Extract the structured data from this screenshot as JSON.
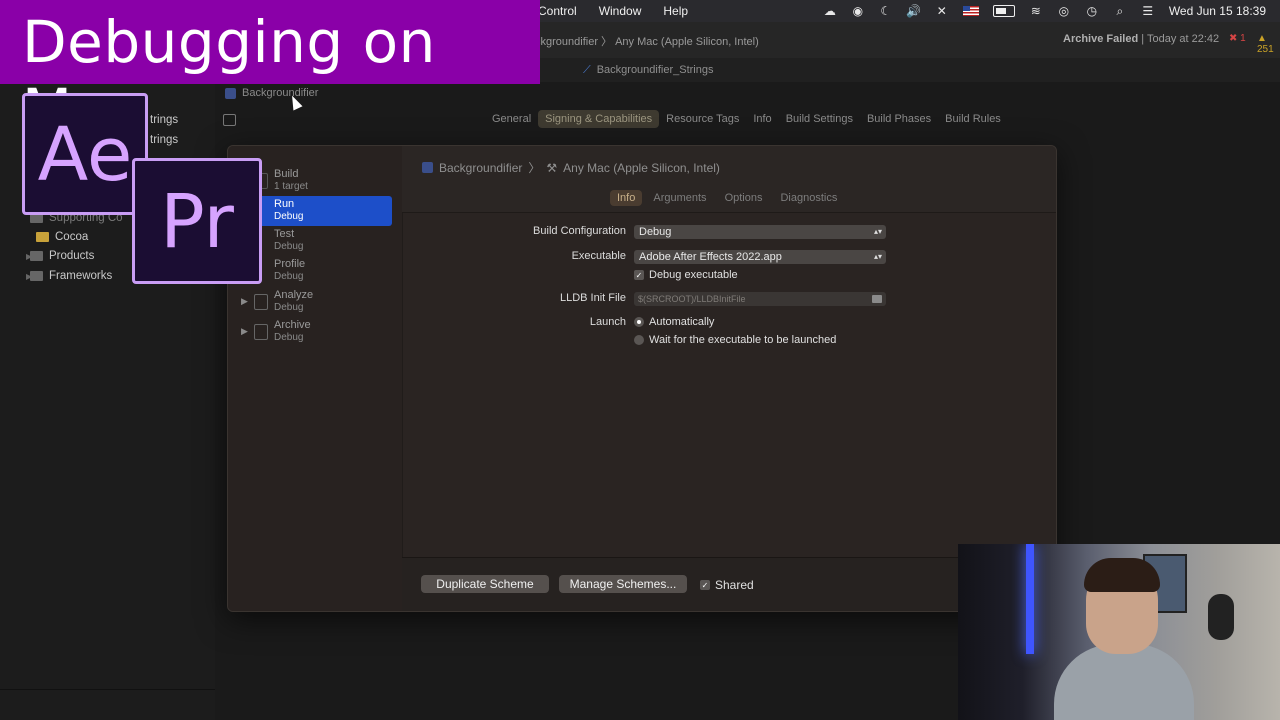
{
  "overlay": {
    "title": "Debugging on Mac",
    "ae_logo": "Ae",
    "pr_logo": "Pr"
  },
  "menubar": {
    "items": [
      "Control",
      "Window",
      "Help"
    ],
    "clock": "Wed Jun 15  18:39"
  },
  "toolbar": {
    "breadcrumb": "ckgroundifier 〉 Any Mac (Apple Silicon, Intel)",
    "status_label": "Archive Failed",
    "status_time": "| Today at 22:42",
    "errors": "1",
    "warnings": "251"
  },
  "tabbar": {
    "file_tab": "Backgroundifier_Strings"
  },
  "navigator": {
    "items": [
      {
        "label": "trings"
      },
      {
        "label": "trings"
      },
      {
        "label": "Supporting Co"
      },
      {
        "label": "Cocoa"
      },
      {
        "label": "Products"
      },
      {
        "label": "Frameworks"
      }
    ]
  },
  "editor": {
    "project": "Backgroundifier",
    "tabs": [
      "General",
      "Signing & Capabilities",
      "Resource Tags",
      "Info",
      "Build Settings",
      "Build Phases",
      "Build Rules"
    ],
    "active_tab": "Signing & Capabilities"
  },
  "scheme": {
    "breadcrumb_project": "Backgroundifier",
    "breadcrumb_dest": "Any Mac (Apple Silicon, Intel)",
    "actions": [
      {
        "name": "Build",
        "sub": "1 target"
      },
      {
        "name": "Run",
        "sub": "Debug"
      },
      {
        "name": "Test",
        "sub": "Debug"
      },
      {
        "name": "Profile",
        "sub": "Debug"
      },
      {
        "name": "Analyze",
        "sub": "Debug"
      },
      {
        "name": "Archive",
        "sub": "Debug"
      }
    ],
    "selected_action": "Run",
    "tabs": [
      "Info",
      "Arguments",
      "Options",
      "Diagnostics"
    ],
    "active_tab": "Info",
    "build_configuration_label": "Build Configuration",
    "build_configuration_value": "Debug",
    "executable_label": "Executable",
    "executable_value": "Adobe After Effects 2022.app",
    "debug_executable_label": "Debug executable",
    "debug_executable_checked": true,
    "lldb_label": "LLDB Init File",
    "lldb_placeholder": "$(SRCROOT)/LLDBInitFile",
    "launch_label": "Launch",
    "launch_options": [
      "Automatically",
      "Wait for the executable to be launched"
    ],
    "launch_selected": "Automatically",
    "duplicate_button": "Duplicate Scheme",
    "manage_button": "Manage Schemes...",
    "shared_label": "Shared",
    "shared_checked": true
  },
  "colors": {
    "selection": "#1d4fc9",
    "banner": "#8a00a8",
    "logo_border": "#c99df5"
  }
}
